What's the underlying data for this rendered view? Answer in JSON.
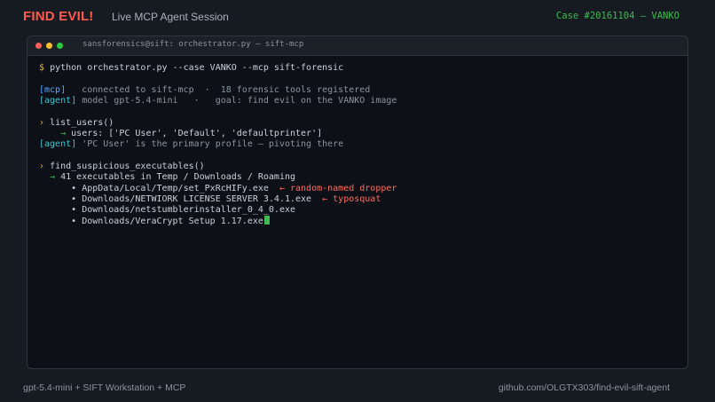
{
  "header": {
    "brand": "FIND EVIL!",
    "session_title": "Live MCP Agent Session",
    "case_id": "Case #20161104 — VANKO"
  },
  "terminal": {
    "title": "sansforensics@sift: orchestrator.py — sift-mcp",
    "command": {
      "prompt": "$",
      "text": "python orchestrator.py --case VANKO --mcp sift-forensic"
    },
    "status": {
      "mcp_tag": "[mcp]",
      "mcp_text": "connected to sift-mcp  ·  18 forensic tools registered",
      "agent_tag": "[agent]",
      "agent_text": "model gpt-5.4-mini   ·   goal: find evil on the VANKO image"
    },
    "step1": {
      "chevron": "›",
      "call": "list_users()",
      "arrow": "→",
      "result": "users: ['PC User', 'Default', 'defaultprinter']",
      "agent_tag": "[agent]",
      "agent_text": "'PC User' is the primary profile — pivoting there"
    },
    "step2": {
      "chevron": "›",
      "call": "find_suspicious_executables()",
      "arrow": "→",
      "summary": "41 executables in Temp / Downloads / Roaming",
      "items": [
        {
          "bullet": "•",
          "path": "AppData/Local/Temp/set_PxRcHIFy.exe",
          "note": "← random-named dropper"
        },
        {
          "bullet": "•",
          "path": "Downloads/NETWIORK LICENSE SERVER 3.4.1.exe",
          "note": "← typosquat"
        },
        {
          "bullet": "•",
          "path": "Downloads/netstumblerinstaller_0_4_0.exe",
          "note": ""
        },
        {
          "bullet": "•",
          "path": "Downloads/VeraCrypt Setup 1.17.exe",
          "note": ""
        }
      ]
    }
  },
  "footer": {
    "stack": "gpt-5.4-mini  +  SIFT Workstation  +  MCP",
    "repo": "github.com/OLGTX303/find-evil-sift-agent"
  },
  "colors": {
    "background": "#161b22",
    "terminal_bg": "#0d1117",
    "brand_red": "#ff5a4f",
    "case_green": "#3fb950",
    "prompt_yellow": "#e3b341",
    "mcp_blue": "#58a6ff",
    "agent_cyan": "#39c5cf",
    "alert_red": "#ff6b5e"
  }
}
